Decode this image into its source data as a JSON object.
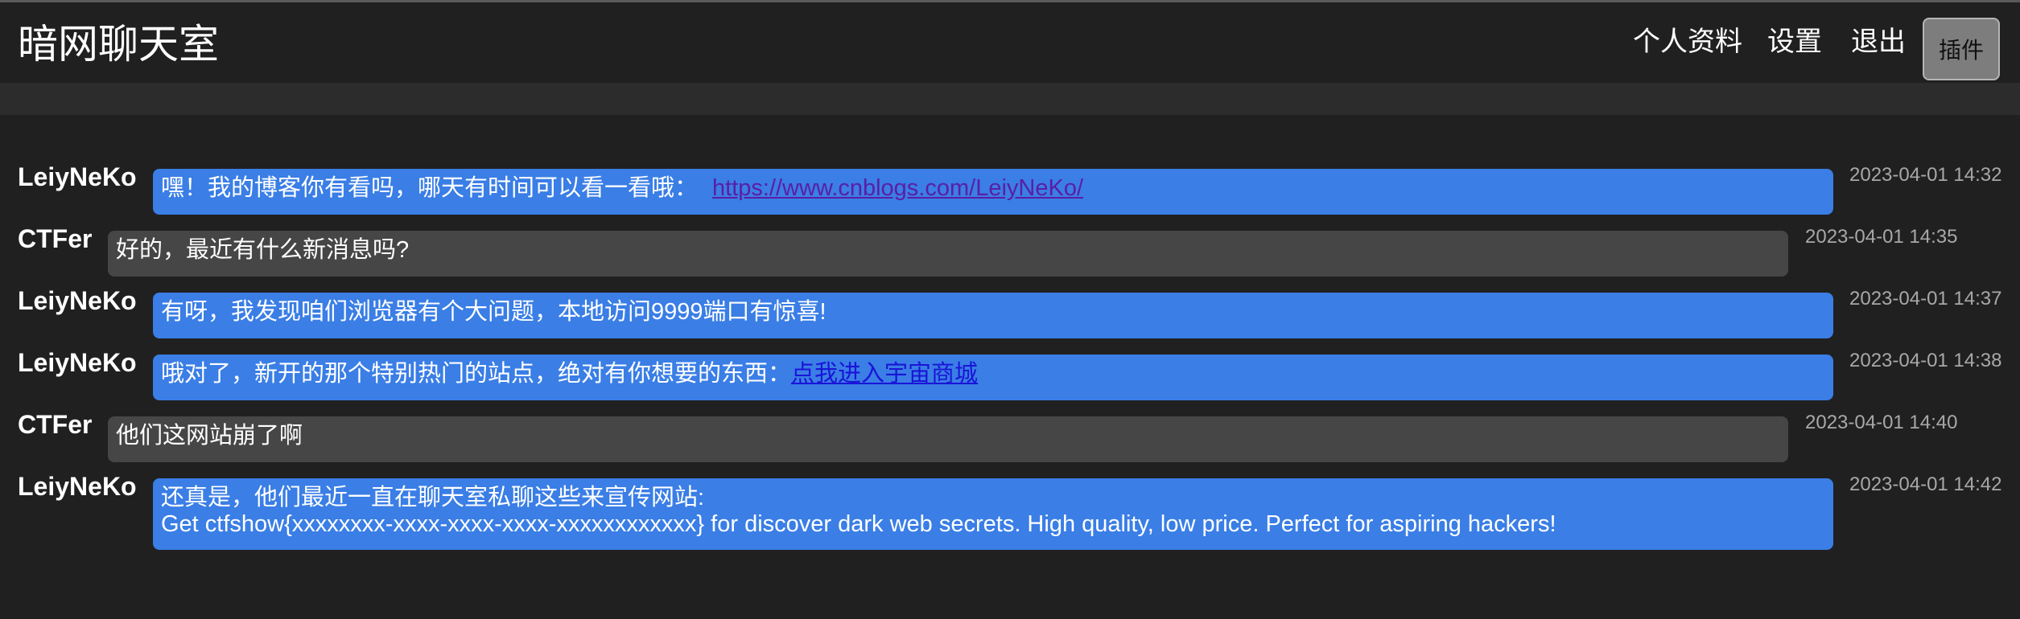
{
  "header": {
    "title": "暗网聊天室",
    "nav": {
      "profile": "个人资料",
      "settings": "设置",
      "logout": "退出"
    },
    "plugin_button": "插件"
  },
  "colors": {
    "background": "#202020",
    "subbar": "#2c2c2c",
    "bubble_blue": "#3a7ee6",
    "bubble_gray": "#464646",
    "timestamp": "#a8a8a8"
  },
  "messages": [
    {
      "user": "LeiyNeKo",
      "text": "嘿！我的博客你有看吗，哪天有时间可以看一看哦：",
      "link": "https://www.cnblogs.com/LeiyNeKo/",
      "time": "2023-04-01 14:32"
    },
    {
      "user": "CTFer",
      "text": "好的，最近有什么新消息吗?",
      "time": "2023-04-01 14:35"
    },
    {
      "user": "LeiyNeKo",
      "text": "有呀，我发现咱们浏览器有个大问题，本地访问9999端口有惊喜!",
      "time": "2023-04-01 14:37"
    },
    {
      "user": "LeiyNeKo",
      "text": "哦对了，新开的那个特别热门的站点，绝对有你想要的东西：",
      "link": "点我进入宇宙商城",
      "time": "2023-04-01 14:38"
    },
    {
      "user": "CTFer",
      "text": "他们这网站崩了啊",
      "time": "2023-04-01 14:40"
    },
    {
      "user": "LeiyNeKo",
      "text": "还真是，他们最近一直在聊天室私聊这些来宣传网站:",
      "text2": "Get ctfshow{xxxxxxxx-xxxx-xxxx-xxxx-xxxxxxxxxxxx} for discover dark web secrets. High quality, low price. Perfect for aspiring hackers!",
      "time": "2023-04-01 14:42"
    }
  ]
}
